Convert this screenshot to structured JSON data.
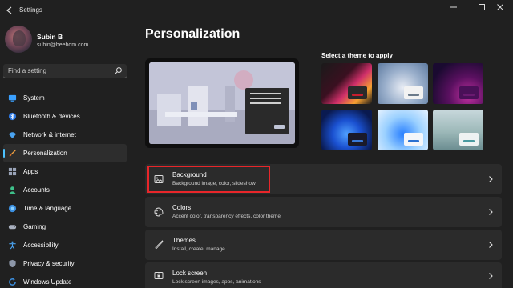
{
  "titlebar": {
    "title": "Settings"
  },
  "profile": {
    "name": "Subin B",
    "email": "subin@beebom.com"
  },
  "search": {
    "placeholder": "Find a setting"
  },
  "sidebar": {
    "items": [
      {
        "label": "System",
        "icon": "monitor-icon"
      },
      {
        "label": "Bluetooth & devices",
        "icon": "bluetooth-icon"
      },
      {
        "label": "Network & internet",
        "icon": "wifi-icon"
      },
      {
        "label": "Personalization",
        "icon": "brush-icon",
        "active": true
      },
      {
        "label": "Apps",
        "icon": "apps-icon"
      },
      {
        "label": "Accounts",
        "icon": "person-icon"
      },
      {
        "label": "Time & language",
        "icon": "globe-icon"
      },
      {
        "label": "Gaming",
        "icon": "gamepad-icon"
      },
      {
        "label": "Accessibility",
        "icon": "accessibility-icon"
      },
      {
        "label": "Privacy & security",
        "icon": "shield-icon"
      },
      {
        "label": "Windows Update",
        "icon": "update-icon"
      }
    ]
  },
  "main": {
    "title": "Personalization",
    "themes_title": "Select a theme to apply",
    "cards": [
      {
        "title": "Background",
        "subtitle": "Background image, color, slideshow",
        "icon": "image-icon"
      },
      {
        "title": "Colors",
        "subtitle": "Accent color, transparency effects, color theme",
        "icon": "palette-icon"
      },
      {
        "title": "Themes",
        "subtitle": "Install, create, manage",
        "icon": "brush-icon"
      },
      {
        "title": "Lock screen",
        "subtitle": "Lock screen images, apps, animations",
        "icon": "lock-screen-icon"
      }
    ]
  },
  "colors": {
    "accent": "#4cc2ff",
    "highlight": "#e8262a",
    "background": "#202020",
    "card": "#2b2b2b"
  }
}
